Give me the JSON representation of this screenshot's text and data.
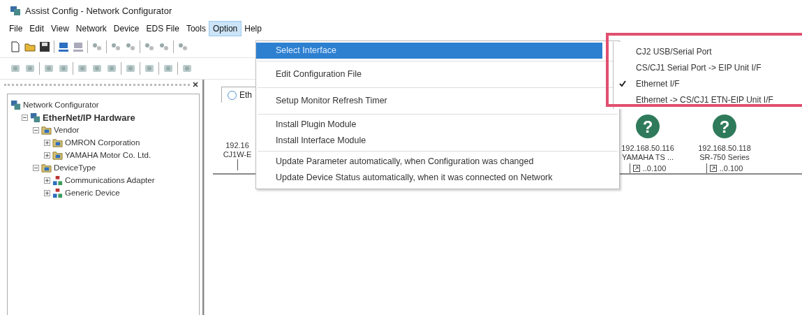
{
  "window": {
    "title": "Assist Config - Network Configurator"
  },
  "menu_bar": [
    {
      "label": "File",
      "selected": false
    },
    {
      "label": "Edit",
      "selected": false
    },
    {
      "label": "View",
      "selected": false
    },
    {
      "label": "Network",
      "selected": false
    },
    {
      "label": "Device",
      "selected": false
    },
    {
      "label": "EDS File",
      "selected": false
    },
    {
      "label": "Tools",
      "selected": false
    },
    {
      "label": "Option",
      "selected": true
    },
    {
      "label": "Help",
      "selected": false
    }
  ],
  "tree": [
    {
      "label": "Network Configurator",
      "kind": "root",
      "children": [
        {
          "label": "EtherNet/IP Hardware",
          "kind": "hardware",
          "expanded": true,
          "children": [
            {
              "label": "Vendor",
              "kind": "folder",
              "expanded": true,
              "children": [
                {
                  "label": "OMRON Corporation",
                  "kind": "folder",
                  "expanded": false
                },
                {
                  "label": "YAMAHA Motor Co. Ltd.",
                  "kind": "folder",
                  "expanded": false
                }
              ]
            },
            {
              "label": "DeviceType",
              "kind": "folder",
              "expanded": true,
              "children": [
                {
                  "label": "Communications Adapter",
                  "kind": "device",
                  "expanded": false
                },
                {
                  "label": "Generic Device",
                  "kind": "device",
                  "expanded": false
                }
              ]
            }
          ]
        }
      ]
    }
  ],
  "canvas": {
    "tab": "Eth",
    "nodes": [
      {
        "ip": "192.16",
        "name": "CJ1W-E",
        "kind": "partial"
      },
      {
        "icon_glyph": "?",
        "ip": "192.168.50.116",
        "name": "YAMAHA TS ...",
        "address": "..0.100",
        "kind": "full"
      },
      {
        "icon_glyph": "?",
        "ip": "192.168.50.118",
        "name": "SR-750 Series",
        "address": "..0.100",
        "kind": "full"
      }
    ]
  },
  "option_menu": {
    "groups": [
      [
        {
          "label": "Select Interface",
          "selected": true
        }
      ],
      [
        {
          "label": "Edit Configuration File",
          "selected": false
        }
      ],
      [
        {
          "label": "Setup Monitor Refresh Timer",
          "selected": false
        }
      ],
      [
        {
          "label": "Install Plugin Module",
          "selected": false
        },
        {
          "label": "Install Interface Module",
          "selected": false
        }
      ],
      [
        {
          "label": "Update Parameter automatically, when Configuration was changed",
          "selected": false
        },
        {
          "label": "Update Device Status automatically, when it was connected on Network",
          "selected": false
        }
      ]
    ]
  },
  "interface_submenu": {
    "items": [
      {
        "label": "CJ2 USB/Serial Port",
        "checked": false
      },
      {
        "label": "CS/CJ1 Serial Port -> EIP Unit I/F",
        "checked": false
      },
      {
        "label": "Ethernet I/F",
        "checked": true
      },
      {
        "label": "Ethernet -> CS/CJ1 ETN-EIP Unit I/F",
        "checked": false
      }
    ]
  }
}
